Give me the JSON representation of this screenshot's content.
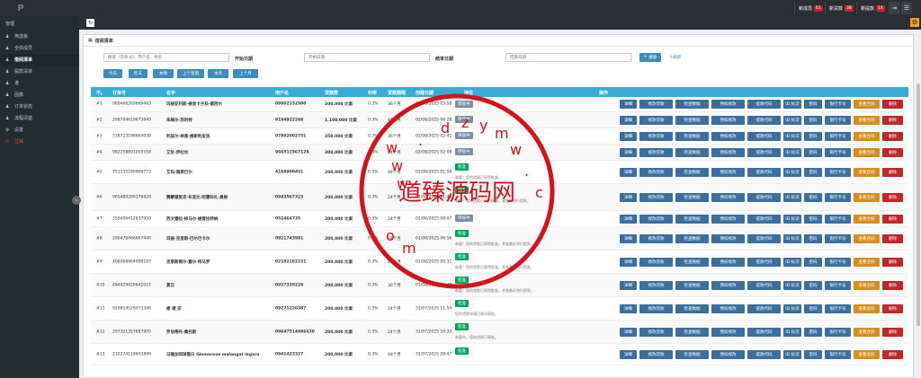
{
  "topbar": {
    "badges": [
      {
        "label": "新成员",
        "count": "61"
      },
      {
        "label": "新贷款",
        "count": "38"
      },
      {
        "label": "新提款",
        "count": "14"
      }
    ],
    "icons": [
      "exit-icon",
      "menu-icon"
    ]
  },
  "sidebar": {
    "heading": "管理",
    "items": [
      {
        "label": "筛选板",
        "icon": "user-icon",
        "active": false
      },
      {
        "label": "全体成员",
        "icon": "user-icon",
        "active": false
      },
      {
        "label": "借阅清单",
        "icon": "user-icon",
        "active": true
      },
      {
        "label": "提款清单",
        "icon": "user-icon",
        "active": false
      },
      {
        "label": "港",
        "icon": "user-icon",
        "active": false
      },
      {
        "label": "固像",
        "icon": "user-icon",
        "active": false
      },
      {
        "label": "订单状态",
        "icon": "user-icon",
        "active": false
      },
      {
        "label": "流程清楚",
        "icon": "user-icon",
        "active": false
      },
      {
        "label": "设置",
        "icon": "gear-icon",
        "active": false
      },
      {
        "label": "注销",
        "icon": "power-icon",
        "active": false
      }
    ]
  },
  "panel": {
    "title": "借阅清单",
    "search_placeholder": "搜索（贷款 ID、用户名、姓名 ...",
    "start_label": "开始日期",
    "start_placeholder": "开始日期",
    "end_label": "结束日期",
    "end_placeholder": "结束日期",
    "search_btn": "搜索",
    "reset_btn": "刷新",
    "quick": [
      "今天",
      "昨天",
      "本周",
      "上个星期",
      "本月",
      "上个月"
    ]
  },
  "table": {
    "headers": [
      "不。",
      "订单号",
      "名字",
      "用户名",
      "贷款数",
      "利率",
      "贷款期限",
      "创建日期",
      "地位",
      "操作"
    ],
    "actions": [
      "详细",
      "修改贷款",
      "检查数据",
      "预扣修改",
      "提款代码",
      "ID 标识",
      "密码",
      "银行卡号",
      "查看合同",
      "删除"
    ],
    "rows": [
      {
        "no": "#1",
        "order": "980466269669463",
        "name": "玛丽亚利斯·维里卡兰科·德西尔",
        "user": "09802152500",
        "amount": "200,000 比索",
        "rate": "0.3%",
        "term": "36个月",
        "date": "02/08/2025 03:58",
        "status": "审核中",
        "status_type": "gray",
        "note": ""
      },
      {
        "no": "#2",
        "order": "298704619673849",
        "name": "朱梅尔·苏利特",
        "user": "9194922248",
        "amount": "1,100,000 比索",
        "rate": "0.3%",
        "term": "48个月",
        "date": "02/08/2025 06:26",
        "status": "审核中",
        "status_type": "gray",
        "note": ""
      },
      {
        "no": "#3",
        "order": "538723198664038",
        "name": "利兹尔·林恩·维斯利皮洛",
        "user": "07802002751",
        "amount": "350,000 比索",
        "rate": "0.3%",
        "term": "36个月",
        "date": "02/08/2025 02:41",
        "status": "审核中",
        "status_type": "gray",
        "note": ""
      },
      {
        "no": "#4",
        "order": "982258891055558",
        "name": "艾伦·伊杜坎",
        "user": "966511567129",
        "amount": "300,000 比索",
        "rate": "0.3%",
        "term": "24个月",
        "date": "02/08/2025 02:08",
        "status": "审核中",
        "status_type": "gray",
        "note": ""
      },
      {
        "no": "#5",
        "order": "751535180909772",
        "name": "艾玛·雅莱巴尔",
        "user": "4168900451",
        "amount": "200,000 比索",
        "rate": "0.3%",
        "term": "48个月",
        "date": "02/08/2025 01:59",
        "status": "批准",
        "status_type": "green",
        "note": "恭喜！您的贷款已获得批准。"
      },
      {
        "no": "#6",
        "order": "965489289376828",
        "name": "赛蒙德里克·布亚比·阿雷科扎·奥根",
        "user": "0943567323",
        "amount": "200,000 比索",
        "rate": "0.3%",
        "term": "24个月",
        "date": "01/08/2025 11:45",
        "status": "批准",
        "status_type": "green",
        "note": "恭喜！您的贷款已获得批准。准备好进行提款。"
      },
      {
        "no": "#7",
        "order": "350406412837950",
        "name": "西文德拉·柿马尔·维普拉特纳",
        "user": "052464735",
        "amount": "200,000 比索",
        "rate": "0.3%",
        "term": "24个月",
        "date": "01/08/2025 08:07",
        "status": "审核中",
        "status_type": "gray",
        "note": ""
      },
      {
        "no": "#8",
        "order": "290476466667440",
        "name": "玛丽·克里斯·巴尔巴卡尔",
        "user": "0921743991",
        "amount": "200,000 比索",
        "rate": "0.3%",
        "term": "24个月",
        "date": "01/08/2025 06:56",
        "status": "批准",
        "status_type": "green",
        "note": "恭喜！您的贷款已获得批准。并准备好进行提款。"
      },
      {
        "no": "#9",
        "order": "408068864998187",
        "name": "克莱斯顿尔·嘉尔·特马罗",
        "user": "02102282231",
        "amount": "200,000 比索",
        "rate": "0.3%",
        "term": "24个月",
        "date": "01/08/2025 05:31",
        "status": "批准",
        "status_type": "green",
        "note": "恭喜！您的贷款已获得批准。并准备好进行提款。"
      },
      {
        "no": "#10",
        "order": "494929426642022",
        "name": "莫汉",
        "user": "0927320229",
        "amount": "200,000 比索",
        "rate": "0.3%",
        "term": "36个月",
        "date": "01/08/2025 04:42",
        "status": "批准",
        "status_type": "green",
        "note": "恭喜！您的贷款已获得批准。并准备好进行提款。"
      },
      {
        "no": "#11",
        "order": "929814529073346",
        "name": "楼 楼 安",
        "user": "09271226387",
        "amount": "200,000 比索",
        "rate": "0.3%",
        "term": "24个月",
        "date": "31/07/2025 11:54",
        "status": "批准",
        "status_type": "green",
        "note": "您的贷款申请已成功获批。"
      },
      {
        "no": "#12",
        "order": "297321357887905",
        "name": "罗伯蒂托·桑托斯",
        "user": "09647514886630",
        "amount": "200,000 比索",
        "rate": "0.3%",
        "term": "24个月",
        "date": "31/07/2025 10:35",
        "status": "批准",
        "status_type": "green",
        "note": "恭喜你，您的贷款已获批。"
      },
      {
        "no": "#13",
        "order": "232274118603896",
        "name": "马隆加同球蛋白 Glemarose malongat legara",
        "user": "0941423327",
        "amount": "200,000 比索",
        "rate": "0.3%",
        "term": "48个月",
        "date": "31/07/2025 09:47",
        "status": "批准",
        "status_type": "green",
        "note": ""
      }
    ]
  },
  "watermark": {
    "text": "道臻源码网",
    "letters": "w w w . d z y m w . c o m",
    "color": "#d4141c"
  }
}
